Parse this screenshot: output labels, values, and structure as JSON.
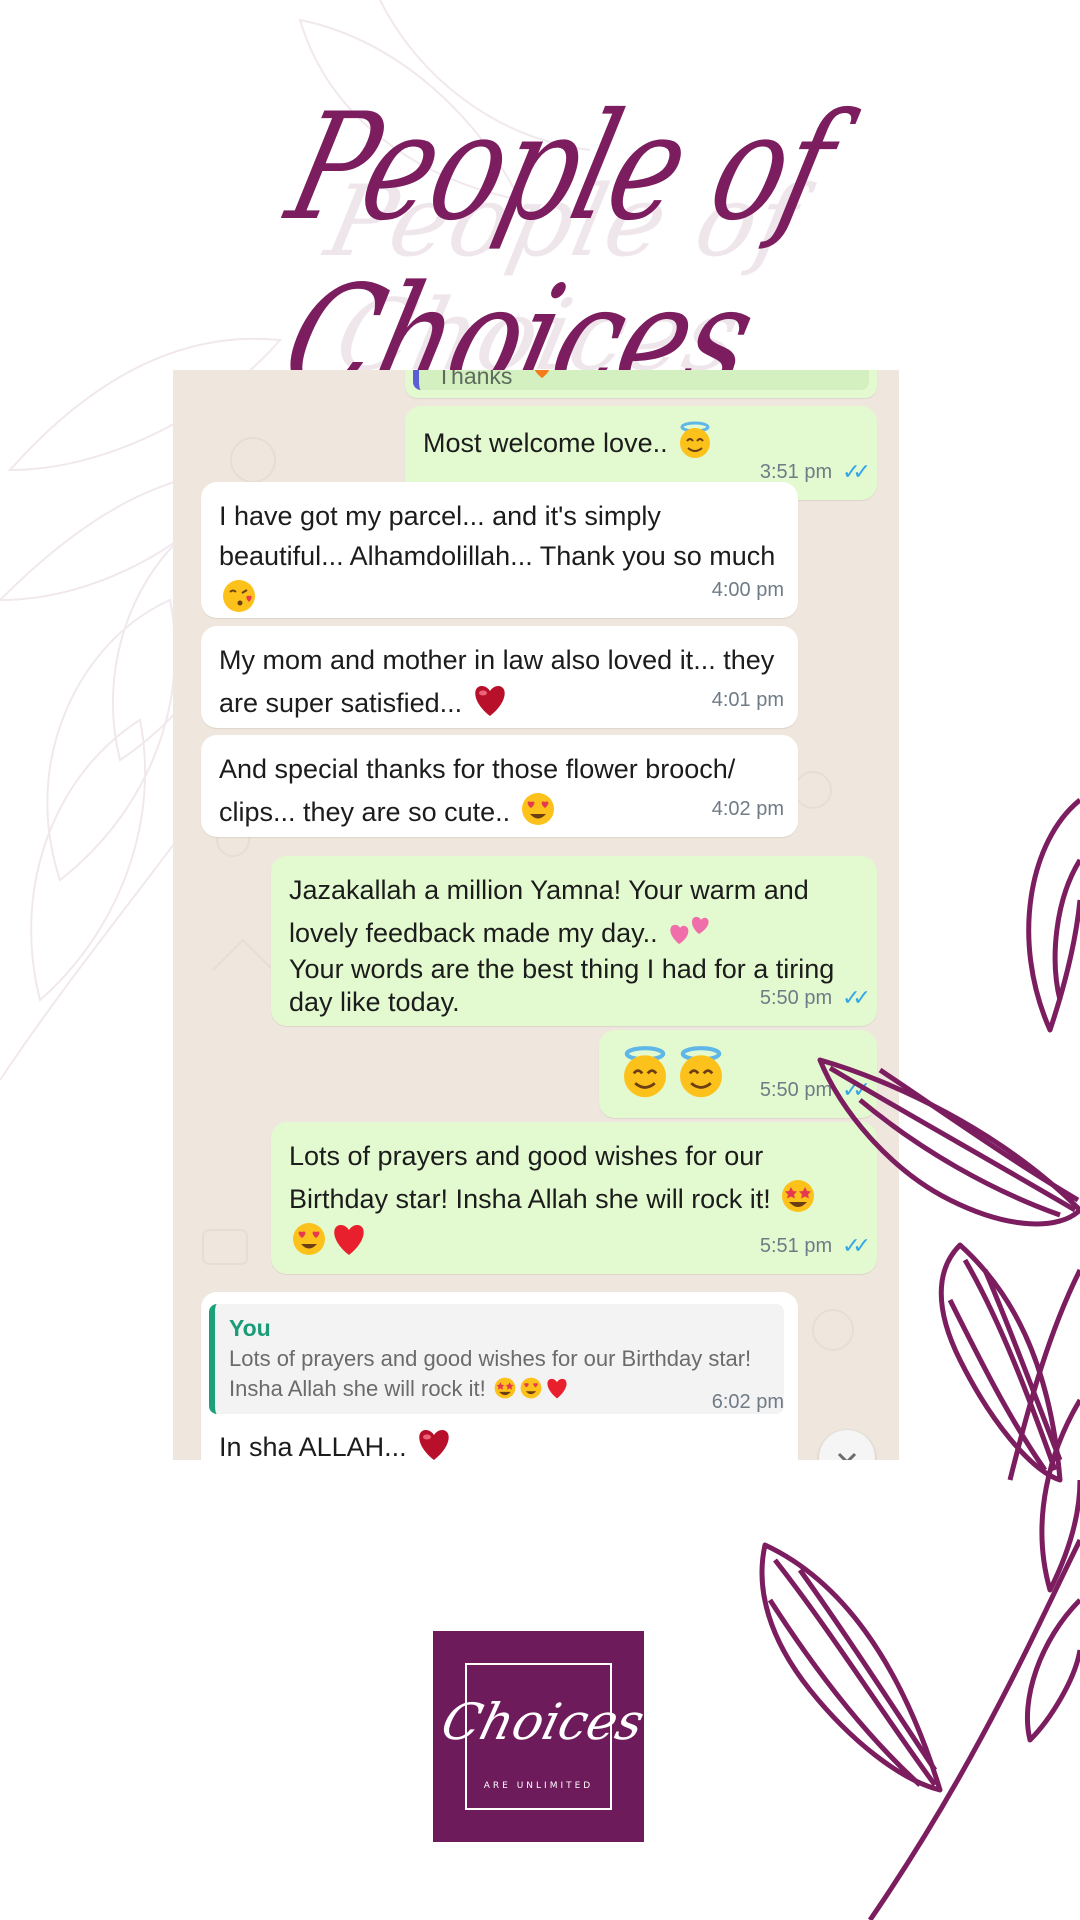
{
  "title": "People of Choices",
  "colors": {
    "brand": "#7b1d5f",
    "chat_bg": "#efe7dd",
    "outgoing": "#e3fad0",
    "incoming": "#ffffff",
    "tick": "#34a6e8"
  },
  "chat": {
    "top_partial_text": "Thanks",
    "messages": [
      {
        "dir": "out",
        "text": "Most welcome love..",
        "emoji": "innocent-emoji",
        "time": "3:51 pm",
        "read": true
      },
      {
        "dir": "in",
        "text": "I have got my parcel... and it's simply beautiful... Alhamdolillah... Thank you so much",
        "emoji": "kiss-emoji",
        "time": "4:00 pm"
      },
      {
        "dir": "in",
        "text": "My mom and mother in law also loved it... they are super satisfied...",
        "emoji": "heart-emoji",
        "time": "4:01 pm"
      },
      {
        "dir": "in",
        "text": "And special thanks for those flower brooch/ clips... they are so cute..",
        "emoji": "heart-eyes-emoji",
        "time": "4:02 pm"
      },
      {
        "dir": "out",
        "text_1": "Jazakallah a million Yamna! Your warm and lovely feedback made my day..",
        "text_2": "Your words are the best thing I had for a tiring day like today.",
        "emoji": "two-hearts-emoji",
        "time": "5:50 pm",
        "read": true
      },
      {
        "dir": "out",
        "emoji": "innocent-emoji",
        "time": "5:50 pm",
        "read": true
      },
      {
        "dir": "out",
        "text": "Lots of prayers and good wishes for our Birthday star! Insha Allah she will rock it!",
        "emoji": "star-struck-emoji",
        "time": "5:51 pm",
        "read": true
      },
      {
        "dir": "in",
        "reply_author": "You",
        "reply_text": "Lots of prayers and good wishes for our Birthday star! Insha Allah she will rock it!",
        "text": "In sha ALLAH...",
        "emoji": "heart-emoji",
        "time": "6:02 pm"
      }
    ]
  },
  "logo": {
    "name": "Choices",
    "tagline": "ARE UNLIMITED"
  }
}
